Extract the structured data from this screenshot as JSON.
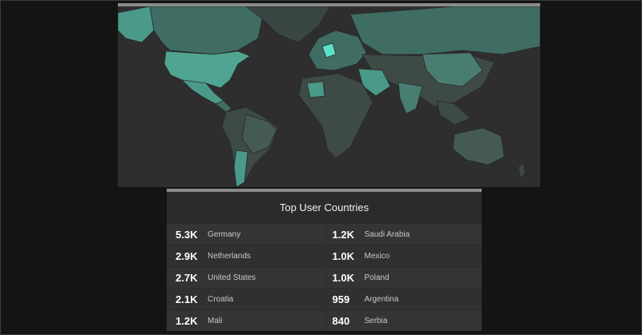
{
  "map": {
    "base_color": "#2e2e2e",
    "land_color": "#3d4a46",
    "accent_color": "#4a9a8a",
    "highlight_color": "#5ce0c8"
  },
  "top_countries": {
    "title": "Top User Countries",
    "rows": [
      [
        {
          "value": "5.3K",
          "country": "Germany"
        },
        {
          "value": "1.2K",
          "country": "Saudi Arabia"
        }
      ],
      [
        {
          "value": "2.9K",
          "country": "Netherlands"
        },
        {
          "value": "1.0K",
          "country": "Mexico"
        }
      ],
      [
        {
          "value": "2.7K",
          "country": "United States"
        },
        {
          "value": "1.0K",
          "country": "Poland"
        }
      ],
      [
        {
          "value": "2.1K",
          "country": "Croatia"
        },
        {
          "value": "959",
          "country": "Argentina"
        }
      ],
      [
        {
          "value": "1.2K",
          "country": "Mali"
        },
        {
          "value": "840",
          "country": "Serbia"
        }
      ]
    ]
  }
}
